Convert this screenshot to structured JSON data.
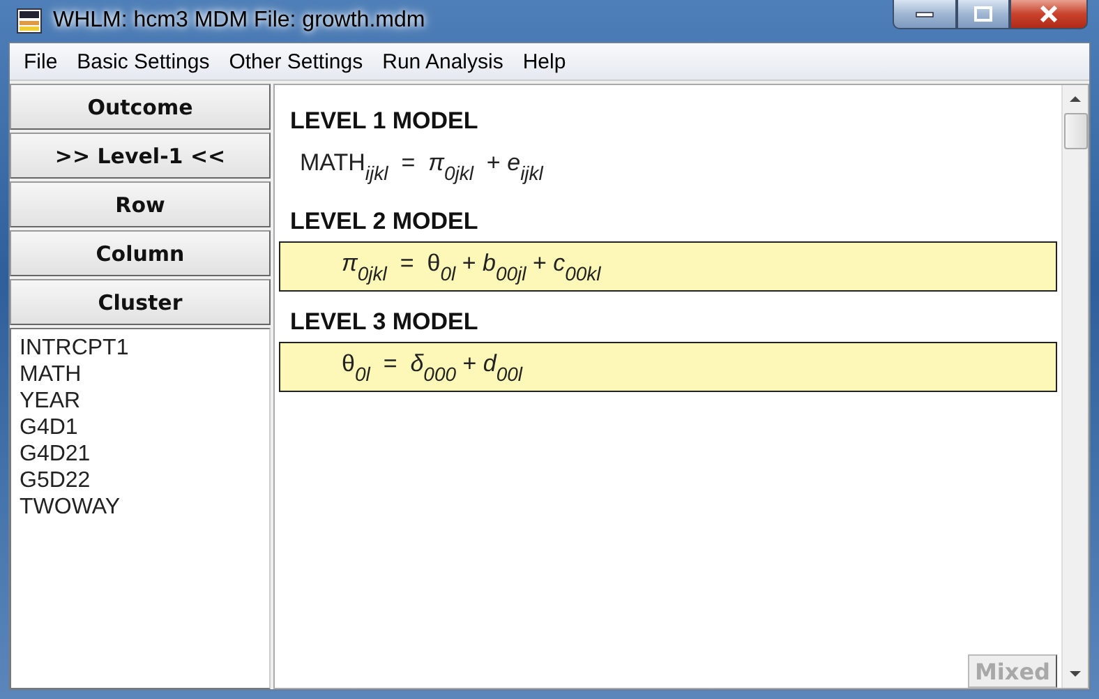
{
  "window": {
    "title": "WHLM: hcm3 MDM File: growth.mdm"
  },
  "menu": [
    "File",
    "Basic Settings",
    "Other Settings",
    "Run Analysis",
    "Help"
  ],
  "model_buttons": [
    {
      "label": "Outcome"
    },
    {
      "label": ">> Level-1 <<"
    },
    {
      "label": "Row"
    },
    {
      "label": "Column"
    },
    {
      "label": "Cluster"
    }
  ],
  "variables": [
    "INTRCPT1",
    "MATH",
    "YEAR",
    "G4D1",
    "G4D21",
    "G5D22",
    "TWOWAY"
  ],
  "models": [
    {
      "heading": "LEVEL 1 MODEL",
      "equation": "MATH$_{ijkl}$  =  *π*$_{0jkl}$  + *e*$_{ijkl}$",
      "highlighted": false
    },
    {
      "heading": "LEVEL 2 MODEL",
      "equation": "*π*$_{0jkl}$  =  θ$_{0l}$ + *b*$_{00jl}$ + *c*$_{00kl}$",
      "highlighted": true
    },
    {
      "heading": "LEVEL 3 MODEL",
      "equation": "θ$_{0l}$  =  *δ*$_{000}$ + *d*$_{00l}$",
      "highlighted": true
    }
  ],
  "mixed_button": {
    "label": "Mixed",
    "disabled": true
  }
}
